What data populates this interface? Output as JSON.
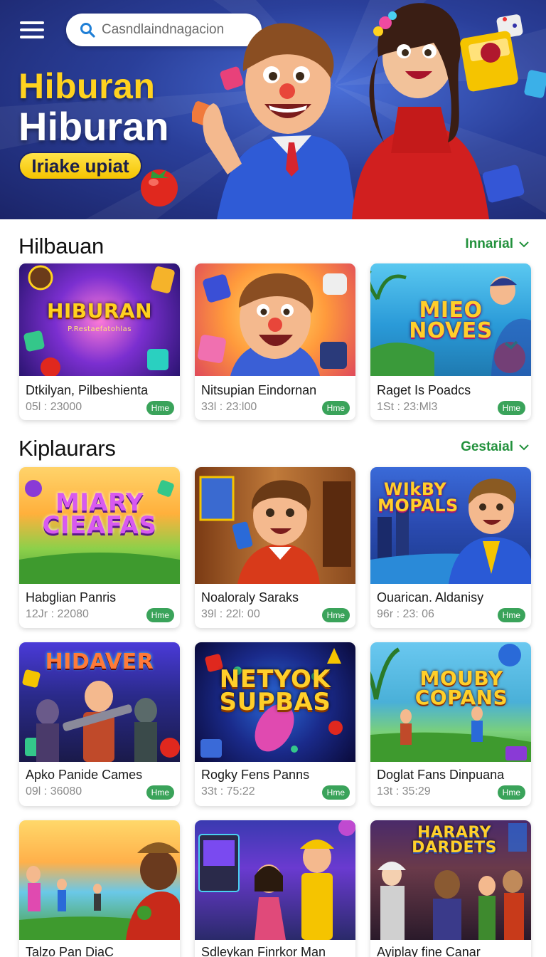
{
  "header": {
    "search_placeholder": "Casndlaindnagacion",
    "title_line1": "Hiburan",
    "title_line2": "Hiburan",
    "cta_label": "Iriake upiat"
  },
  "sections": [
    {
      "title": "Hilbauan",
      "link_label": "Innarial",
      "cards": [
        {
          "name": "Dtkilyan, Pilbeshienta",
          "meta": "05l : 23000",
          "badge": "Hme",
          "logo": "HIBURAN",
          "logo_sub": "P.Restaefatohlas"
        },
        {
          "name": "Nitsupian Eindornan",
          "meta": "33l : 23:l00",
          "badge": "Hme",
          "logo": "",
          "logo_sub": ""
        },
        {
          "name": "Raget Is Poadcs",
          "meta": "1St : 23:Ml3",
          "badge": "Hme",
          "logo": "MIEO NOVES",
          "logo_sub": ""
        }
      ]
    },
    {
      "title": "Kiplaurars",
      "link_label": "Gestaial",
      "cards": [
        {
          "name": "Habglian Panris",
          "meta": "12Jr : 22080",
          "badge": "Hme",
          "logo": "MIARY CIEAFAS",
          "logo_sub": ""
        },
        {
          "name": "Noaloraly Saraks",
          "meta": "39l : 22l: 00",
          "badge": "Hme",
          "logo": "",
          "logo_sub": ""
        },
        {
          "name": "Ouarican. Aldanisy",
          "meta": "96r : 23: 06",
          "badge": "Hme",
          "logo": "WIkBY MOPALS",
          "logo_sub": ""
        }
      ]
    },
    {
      "title": "",
      "link_label": "",
      "cards": [
        {
          "name": "Apko Panide Cames",
          "meta": "09l : 36080",
          "badge": "Hme",
          "logo": "HIDAVER",
          "logo_sub": ""
        },
        {
          "name": "Rogky Fens Panns",
          "meta": "33t : 75:22",
          "badge": "Hme",
          "logo": "NETYOK SUPBAS",
          "logo_sub": ""
        },
        {
          "name": "Doglat Fans Dinpuana",
          "meta": "13t : 35:29",
          "badge": "Hme",
          "logo": "MOUBY COPANS",
          "logo_sub": ""
        }
      ]
    },
    {
      "title": "",
      "link_label": "",
      "cards": [
        {
          "name": "Talzo Pan DiaC",
          "meta": "",
          "badge": "",
          "logo": "",
          "logo_sub": ""
        },
        {
          "name": "Sdleykan Finrkor Man",
          "meta": "",
          "badge": "",
          "logo": "",
          "logo_sub": ""
        },
        {
          "name": "Ayiplay fine Canar",
          "meta": "",
          "badge": "",
          "logo": "HARARY DARDETS",
          "logo_sub": ""
        }
      ]
    }
  ],
  "colors": {
    "accent_green": "#22913c",
    "badge_green": "#3aa35a",
    "hero_yellow": "#ffd21f",
    "hero_blue": "#2a3f9a"
  },
  "icons": [
    "menu-icon",
    "search-icon",
    "chevron-down-icon"
  ]
}
